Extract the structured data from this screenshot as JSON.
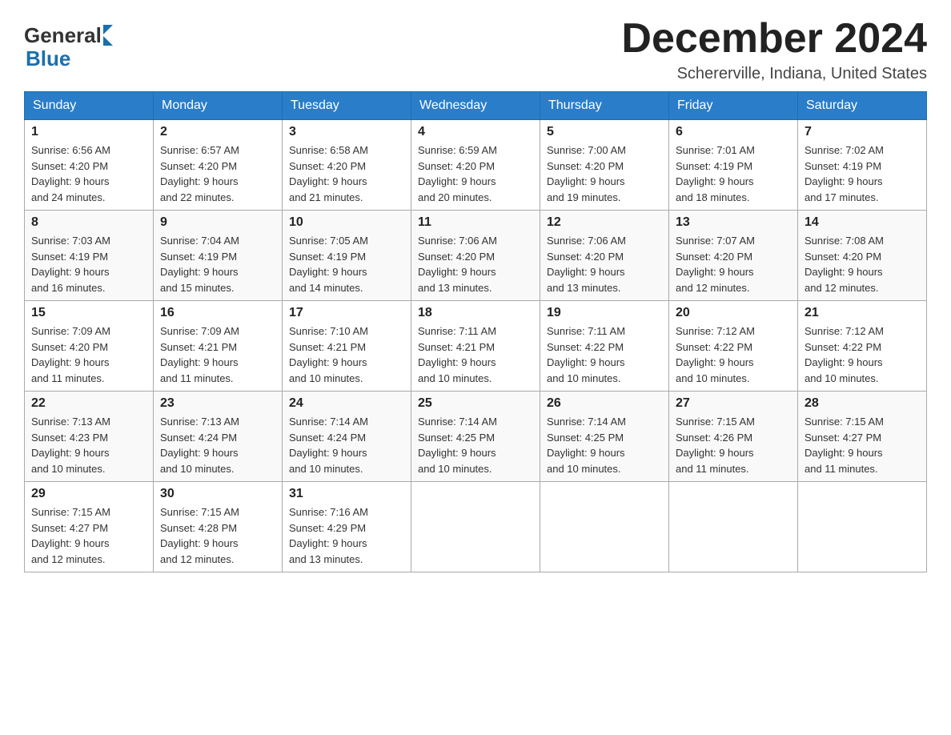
{
  "header": {
    "logo_general": "General",
    "logo_blue": "Blue",
    "month_title": "December 2024",
    "location": "Schererville, Indiana, United States"
  },
  "days_of_week": [
    "Sunday",
    "Monday",
    "Tuesday",
    "Wednesday",
    "Thursday",
    "Friday",
    "Saturday"
  ],
  "weeks": [
    [
      {
        "day": "1",
        "sunrise": "6:56 AM",
        "sunset": "4:20 PM",
        "daylight": "9 hours and 24 minutes."
      },
      {
        "day": "2",
        "sunrise": "6:57 AM",
        "sunset": "4:20 PM",
        "daylight": "9 hours and 22 minutes."
      },
      {
        "day": "3",
        "sunrise": "6:58 AM",
        "sunset": "4:20 PM",
        "daylight": "9 hours and 21 minutes."
      },
      {
        "day": "4",
        "sunrise": "6:59 AM",
        "sunset": "4:20 PM",
        "daylight": "9 hours and 20 minutes."
      },
      {
        "day": "5",
        "sunrise": "7:00 AM",
        "sunset": "4:20 PM",
        "daylight": "9 hours and 19 minutes."
      },
      {
        "day": "6",
        "sunrise": "7:01 AM",
        "sunset": "4:19 PM",
        "daylight": "9 hours and 18 minutes."
      },
      {
        "day": "7",
        "sunrise": "7:02 AM",
        "sunset": "4:19 PM",
        "daylight": "9 hours and 17 minutes."
      }
    ],
    [
      {
        "day": "8",
        "sunrise": "7:03 AM",
        "sunset": "4:19 PM",
        "daylight": "9 hours and 16 minutes."
      },
      {
        "day": "9",
        "sunrise": "7:04 AM",
        "sunset": "4:19 PM",
        "daylight": "9 hours and 15 minutes."
      },
      {
        "day": "10",
        "sunrise": "7:05 AM",
        "sunset": "4:19 PM",
        "daylight": "9 hours and 14 minutes."
      },
      {
        "day": "11",
        "sunrise": "7:06 AM",
        "sunset": "4:20 PM",
        "daylight": "9 hours and 13 minutes."
      },
      {
        "day": "12",
        "sunrise": "7:06 AM",
        "sunset": "4:20 PM",
        "daylight": "9 hours and 13 minutes."
      },
      {
        "day": "13",
        "sunrise": "7:07 AM",
        "sunset": "4:20 PM",
        "daylight": "9 hours and 12 minutes."
      },
      {
        "day": "14",
        "sunrise": "7:08 AM",
        "sunset": "4:20 PM",
        "daylight": "9 hours and 12 minutes."
      }
    ],
    [
      {
        "day": "15",
        "sunrise": "7:09 AM",
        "sunset": "4:20 PM",
        "daylight": "9 hours and 11 minutes."
      },
      {
        "day": "16",
        "sunrise": "7:09 AM",
        "sunset": "4:21 PM",
        "daylight": "9 hours and 11 minutes."
      },
      {
        "day": "17",
        "sunrise": "7:10 AM",
        "sunset": "4:21 PM",
        "daylight": "9 hours and 10 minutes."
      },
      {
        "day": "18",
        "sunrise": "7:11 AM",
        "sunset": "4:21 PM",
        "daylight": "9 hours and 10 minutes."
      },
      {
        "day": "19",
        "sunrise": "7:11 AM",
        "sunset": "4:22 PM",
        "daylight": "9 hours and 10 minutes."
      },
      {
        "day": "20",
        "sunrise": "7:12 AM",
        "sunset": "4:22 PM",
        "daylight": "9 hours and 10 minutes."
      },
      {
        "day": "21",
        "sunrise": "7:12 AM",
        "sunset": "4:22 PM",
        "daylight": "9 hours and 10 minutes."
      }
    ],
    [
      {
        "day": "22",
        "sunrise": "7:13 AM",
        "sunset": "4:23 PM",
        "daylight": "9 hours and 10 minutes."
      },
      {
        "day": "23",
        "sunrise": "7:13 AM",
        "sunset": "4:24 PM",
        "daylight": "9 hours and 10 minutes."
      },
      {
        "day": "24",
        "sunrise": "7:14 AM",
        "sunset": "4:24 PM",
        "daylight": "9 hours and 10 minutes."
      },
      {
        "day": "25",
        "sunrise": "7:14 AM",
        "sunset": "4:25 PM",
        "daylight": "9 hours and 10 minutes."
      },
      {
        "day": "26",
        "sunrise": "7:14 AM",
        "sunset": "4:25 PM",
        "daylight": "9 hours and 10 minutes."
      },
      {
        "day": "27",
        "sunrise": "7:15 AM",
        "sunset": "4:26 PM",
        "daylight": "9 hours and 11 minutes."
      },
      {
        "day": "28",
        "sunrise": "7:15 AM",
        "sunset": "4:27 PM",
        "daylight": "9 hours and 11 minutes."
      }
    ],
    [
      {
        "day": "29",
        "sunrise": "7:15 AM",
        "sunset": "4:27 PM",
        "daylight": "9 hours and 12 minutes."
      },
      {
        "day": "30",
        "sunrise": "7:15 AM",
        "sunset": "4:28 PM",
        "daylight": "9 hours and 12 minutes."
      },
      {
        "day": "31",
        "sunrise": "7:16 AM",
        "sunset": "4:29 PM",
        "daylight": "9 hours and 13 minutes."
      },
      null,
      null,
      null,
      null
    ]
  ],
  "labels": {
    "sunrise": "Sunrise: ",
    "sunset": "Sunset: ",
    "daylight": "Daylight: "
  }
}
